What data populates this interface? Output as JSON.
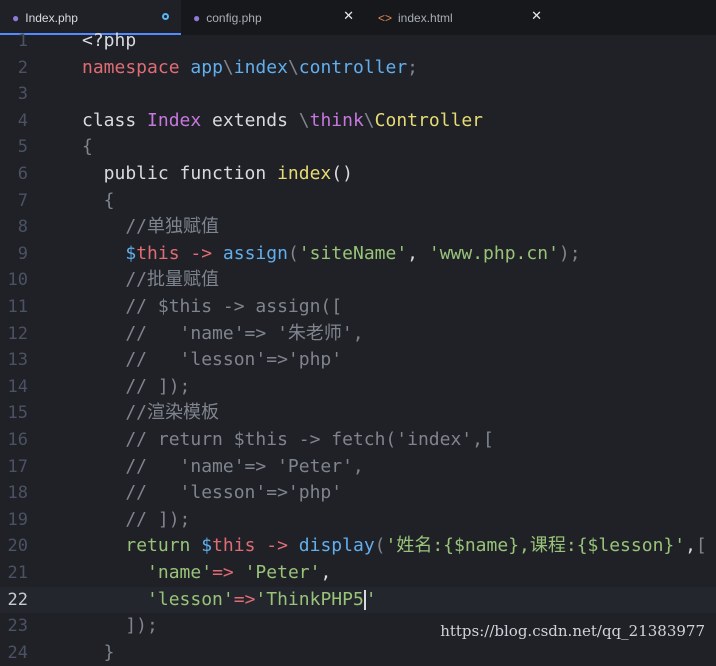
{
  "tabs": [
    {
      "label": "Index.php",
      "icon": "elephant-icon",
      "state": "modified"
    },
    {
      "label": "config.php",
      "icon": "elephant-icon",
      "state": "close"
    },
    {
      "label": "index.html",
      "icon": "code-brackets-icon",
      "state": "close"
    }
  ],
  "close_glyph": "✕",
  "current_line": 22,
  "lines": [
    {
      "n": "1",
      "t": [
        [
          "<?php",
          "plain"
        ]
      ]
    },
    {
      "n": "2",
      "t": [
        [
          "namespace",
          "red"
        ],
        [
          " ",
          "plain"
        ],
        [
          "app",
          "ns"
        ],
        [
          "\\",
          "com"
        ],
        [
          "index",
          "ns"
        ],
        [
          "\\",
          "com"
        ],
        [
          "controller",
          "ns"
        ],
        [
          ";",
          "com"
        ]
      ]
    },
    {
      "n": "3",
      "t": []
    },
    {
      "n": "4",
      "t": [
        [
          "class",
          "plain"
        ],
        [
          " ",
          "plain"
        ],
        [
          "Index",
          "kw"
        ],
        [
          " extends ",
          "plain"
        ],
        [
          "\\",
          "com"
        ],
        [
          "think",
          "kw"
        ],
        [
          "\\",
          "com"
        ],
        [
          "Controller",
          "fn"
        ]
      ]
    },
    {
      "n": "5",
      "t": [
        [
          "{",
          "com"
        ]
      ]
    },
    {
      "n": "6",
      "t": [
        [
          "  public function ",
          "plain"
        ],
        [
          "index",
          "fn"
        ],
        [
          "()",
          "plain"
        ]
      ]
    },
    {
      "n": "7",
      "t": [
        [
          "  {",
          "com"
        ]
      ]
    },
    {
      "n": "8",
      "t": [
        [
          "    //单独赋值",
          "com"
        ]
      ]
    },
    {
      "n": "9",
      "t": [
        [
          "    ",
          "plain"
        ],
        [
          "$",
          "blue"
        ],
        [
          "this",
          "red"
        ],
        [
          " -> ",
          "red"
        ],
        [
          "assign",
          "blue"
        ],
        [
          "(",
          "com"
        ],
        [
          "'siteName'",
          "green"
        ],
        [
          ", ",
          "plain"
        ],
        [
          "'www.php.cn'",
          "green"
        ],
        [
          ");",
          "com"
        ]
      ]
    },
    {
      "n": "10",
      "t": [
        [
          "    //批量赋值",
          "com"
        ]
      ]
    },
    {
      "n": "11",
      "t": [
        [
          "    // $this -> assign([",
          "com"
        ]
      ]
    },
    {
      "n": "12",
      "t": [
        [
          "    //   'name'=> '朱老师',",
          "com"
        ]
      ]
    },
    {
      "n": "13",
      "t": [
        [
          "    //   'lesson'=>'php'",
          "com"
        ]
      ]
    },
    {
      "n": "14",
      "t": [
        [
          "    // ]);",
          "com"
        ]
      ]
    },
    {
      "n": "15",
      "t": [
        [
          "    //渲染模板",
          "com"
        ]
      ]
    },
    {
      "n": "16",
      "t": [
        [
          "    // return $this -> fetch('index',[",
          "com"
        ]
      ]
    },
    {
      "n": "17",
      "t": [
        [
          "    //   'name'=> 'Peter',",
          "com"
        ]
      ]
    },
    {
      "n": "18",
      "t": [
        [
          "    //   'lesson'=>'php'",
          "com"
        ]
      ]
    },
    {
      "n": "19",
      "t": [
        [
          "    // ]);",
          "com"
        ]
      ]
    },
    {
      "n": "20",
      "t": [
        [
          "    ",
          "plain"
        ],
        [
          "return",
          "green"
        ],
        [
          " ",
          "plain"
        ],
        [
          "$",
          "blue"
        ],
        [
          "this",
          "red"
        ],
        [
          " -> ",
          "red"
        ],
        [
          "display",
          "blue"
        ],
        [
          "(",
          "com"
        ],
        [
          "'姓名:{$name},课程:{$lesson}'",
          "green"
        ],
        [
          ",",
          "plain"
        ],
        [
          "[",
          "com"
        ]
      ]
    },
    {
      "n": "21",
      "t": [
        [
          "      ",
          "plain"
        ],
        [
          "'name'",
          "green"
        ],
        [
          "=>",
          "red"
        ],
        [
          " ",
          "plain"
        ],
        [
          "'Peter'",
          "green"
        ],
        [
          ",",
          "plain"
        ]
      ]
    },
    {
      "n": "22",
      "t": [
        [
          "      ",
          "plain"
        ],
        [
          "'lesson'",
          "green"
        ],
        [
          "=>",
          "red"
        ],
        [
          "'ThinkPHP5",
          "green"
        ],
        [
          "|",
          "caret"
        ],
        [
          "'",
          "green"
        ]
      ]
    },
    {
      "n": "23",
      "t": [
        [
          "    ]);",
          "com"
        ]
      ]
    },
    {
      "n": "24",
      "t": [
        [
          "  }",
          "com"
        ]
      ]
    }
  ],
  "watermark": "https://blog.csdn.net/qq_21383977"
}
